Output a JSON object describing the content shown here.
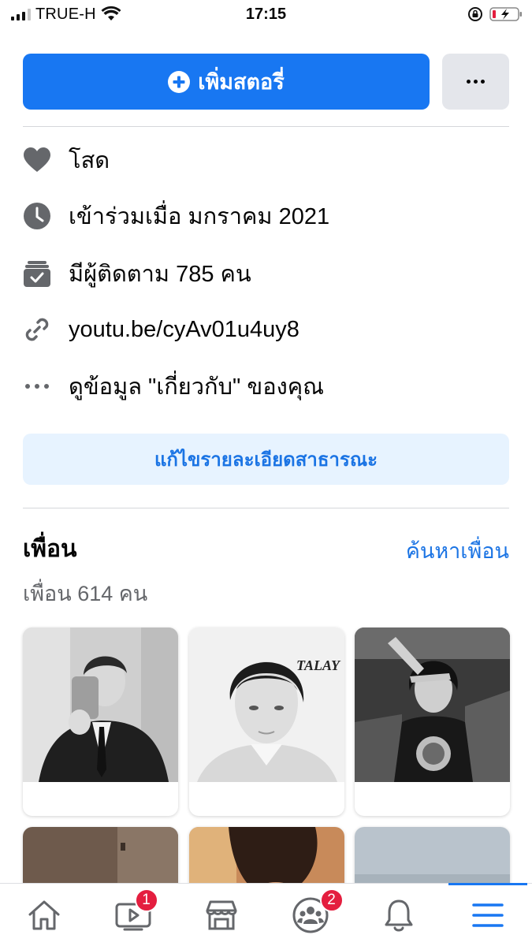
{
  "status_bar": {
    "carrier": "TRUE-H",
    "time": "17:15"
  },
  "actions": {
    "add_story_label": "เพิ่มสตอรี่"
  },
  "info": {
    "relationship": "โสด",
    "joined": "เข้าร่วมเมื่อ มกราคม  2021",
    "followers": "มีผู้ติดตาม 785 คน",
    "link": "youtu.be/cyAv01u4uy8",
    "see_about": "ดูข้อมูล \"เกี่ยวกับ\" ของคุณ"
  },
  "edit_details_label": "แก้ไขรายละเอียดสาธารณะ",
  "friends": {
    "title": "เพื่อน",
    "find_label": "ค้นหาเพื่อน",
    "count_label": "เพื่อน 614 คน",
    "watermark": "TALAY"
  },
  "bottom_nav": {
    "watch_badge": "1",
    "groups_badge": "2"
  },
  "colors": {
    "accent": "#1877f2",
    "accent_light": "#e7f3ff",
    "badge": "#e41e3f",
    "icon_gray": "#65676b"
  },
  "icons": [
    "heart-icon",
    "clock-icon",
    "followers-icon",
    "link-icon",
    "more-dots-icon",
    "home-icon",
    "watch-icon",
    "marketplace-icon",
    "groups-icon",
    "bell-icon",
    "menu-icon"
  ]
}
